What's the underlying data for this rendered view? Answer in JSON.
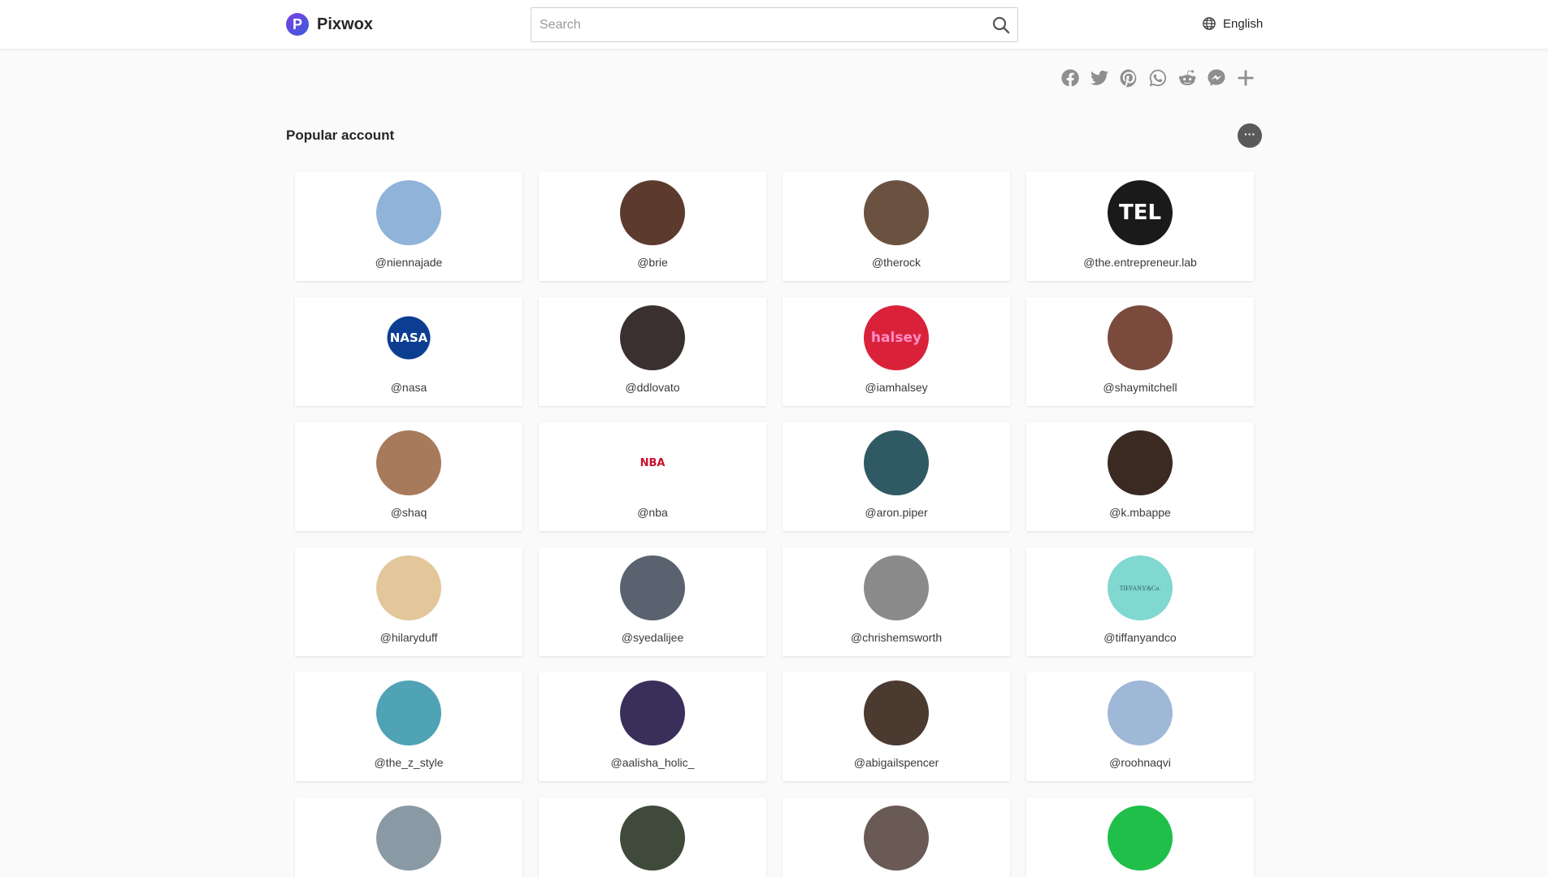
{
  "brand": {
    "name": "Pixwox",
    "mark": "P"
  },
  "search": {
    "placeholder": "Search",
    "value": ""
  },
  "language": {
    "label": "English"
  },
  "share_icons": [
    "facebook-icon",
    "twitter-icon",
    "pinterest-icon",
    "whatsapp-icon",
    "reddit-icon",
    "messenger-icon",
    "plus-icon"
  ],
  "section": {
    "title": "Popular account",
    "more_label": "···"
  },
  "accounts": [
    {
      "handle": "@niennajade",
      "color": "#8fb3d9",
      "glyph": ""
    },
    {
      "handle": "@brie",
      "color": "#5c3a2e",
      "glyph": ""
    },
    {
      "handle": "@therock",
      "color": "#6b5240",
      "glyph": ""
    },
    {
      "handle": "@the.entrepreneur.lab",
      "color": "#1a1a1a",
      "glyph": "TEL"
    },
    {
      "handle": "@nasa",
      "color": "#ffffff",
      "glyph": "NASA"
    },
    {
      "handle": "@ddlovato",
      "color": "#3b3030",
      "glyph": ""
    },
    {
      "handle": "@iamhalsey",
      "color": "#d9223a",
      "glyph": "halsey"
    },
    {
      "handle": "@shaymitchell",
      "color": "#7a4a3c",
      "glyph": ""
    },
    {
      "handle": "@shaq",
      "color": "#a87a5c",
      "glyph": ""
    },
    {
      "handle": "@nba",
      "color": "#ffffff",
      "glyph": "NBA"
    },
    {
      "handle": "@aron.piper",
      "color": "#2f5a63",
      "glyph": ""
    },
    {
      "handle": "@k.mbappe",
      "color": "#3a2a22",
      "glyph": ""
    },
    {
      "handle": "@hilaryduff",
      "color": "#e3c79a",
      "glyph": ""
    },
    {
      "handle": "@syedalijee",
      "color": "#5a6270",
      "glyph": ""
    },
    {
      "handle": "@chrishemsworth",
      "color": "#8a8a8a",
      "glyph": ""
    },
    {
      "handle": "@tiffanyandco",
      "color": "#81d8d0",
      "glyph": "TIFFANY&Co."
    },
    {
      "handle": "@the_z_style",
      "color": "#4fa3b5",
      "glyph": ""
    },
    {
      "handle": "@aalisha_holic_",
      "color": "#3a2f5a",
      "glyph": ""
    },
    {
      "handle": "@abigailspencer",
      "color": "#4a3a30",
      "glyph": ""
    },
    {
      "handle": "@roohnaqvi",
      "color": "#9fb8d8",
      "glyph": ""
    },
    {
      "handle": "",
      "color": "#8a9aa5",
      "glyph": ""
    },
    {
      "handle": "",
      "color": "#3f4a3a",
      "glyph": ""
    },
    {
      "handle": "",
      "color": "#6a5a55",
      "glyph": ""
    },
    {
      "handle": "",
      "color": "#1fbf4a",
      "glyph": ""
    }
  ]
}
